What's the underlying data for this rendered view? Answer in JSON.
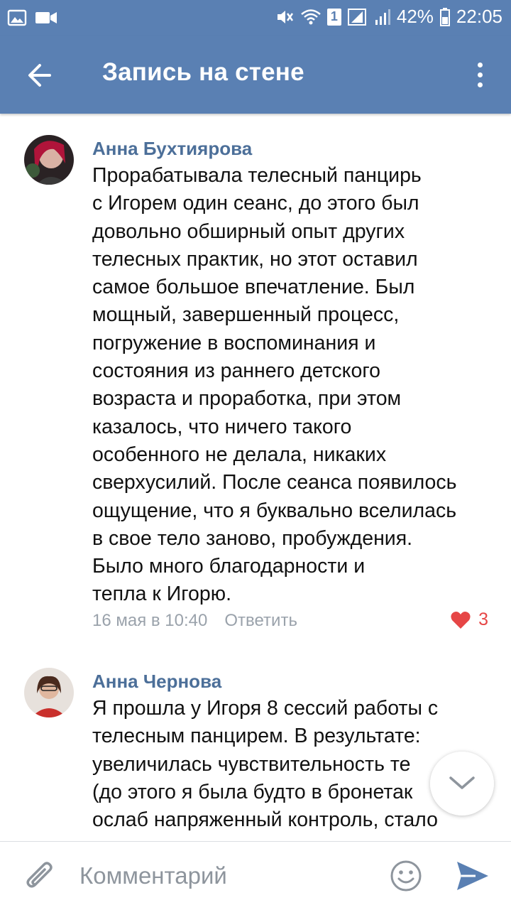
{
  "status": {
    "battery": "42%",
    "time": "22:05",
    "sim": "1"
  },
  "header": {
    "title": "Запись на стене"
  },
  "comments": [
    {
      "author": "Анна Бухтиярова",
      "text": "Прорабатывала телесный панцирь\nс Игорем один сеанс, до этого был\nдовольно обширный опыт других\nтелесных практик, но этот оставил\nсамое большое впечатление. Был\nмощный, завершенный процесс,\nпогружение в воспоминания и\nсостояния из раннего детского\nвозраста и проработка, при этом\nказалось, что ничего такого\nособенного не делала, никаких\nсверхусилий. После сеанса появилось\nощущение, что я буквально вселилась\nв свое тело заново, пробуждения.\nБыло много благодарности и\nтепла к Игорю.",
      "date": "16 мая в 10:40",
      "reply_label": "Ответить",
      "likes": "3"
    },
    {
      "author": "Анна Чернова",
      "text": "Я прошла у Игоря 8 сессий работы с\nтелесным панцирем. В результате:\nувеличилась чувствительность те\n(до этого я была будто в бронетак\nослаб напряженный контроль, стало"
    }
  ],
  "input": {
    "placeholder": "Комментарий"
  },
  "colors": {
    "header": "#5a80b3",
    "author": "#4c6f99",
    "like": "#e64646"
  }
}
